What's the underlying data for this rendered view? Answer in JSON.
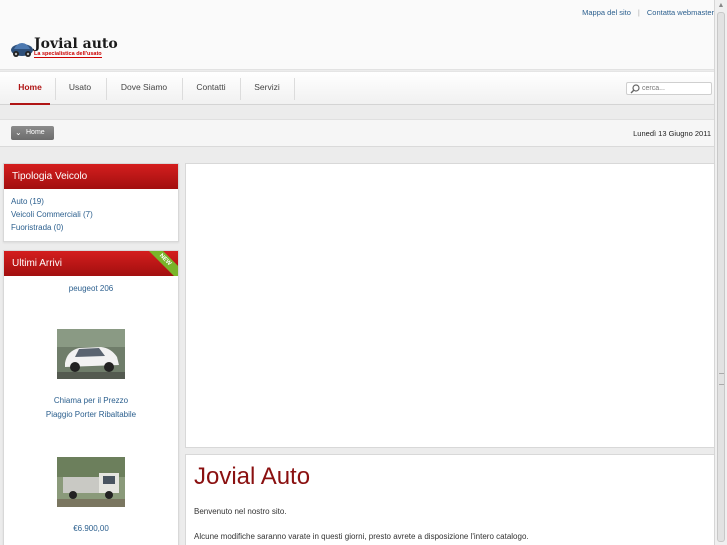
{
  "header": {
    "links": [
      "Mappa del sito",
      "Contatta webmaster"
    ],
    "logo_title": "Jovial auto",
    "logo_subtitle": "La specialistica dell'usato"
  },
  "nav": {
    "items": [
      {
        "label": "Home",
        "active": true
      },
      {
        "label": "Usato",
        "active": false
      },
      {
        "label": "Dove Siamo",
        "active": false
      },
      {
        "label": "Contatti",
        "active": false
      },
      {
        "label": "Servizi",
        "active": false
      }
    ],
    "search_placeholder": "cerca..."
  },
  "breadcrumb": {
    "label": "Home",
    "date": "Lunedì 13 Giugno 2011"
  },
  "sidebar": {
    "tipologia": {
      "title": "Tipologia Veicolo",
      "items": [
        "Auto (19)",
        "Veicoli Commerciali (7)",
        "Fuoristrada (0)"
      ]
    },
    "arrivi": {
      "title": "Ultimi Arrivi",
      "ribbon": "NEW",
      "items": [
        {
          "name": "peugeot 206",
          "price": "Chiama per il Prezzo"
        },
        {
          "name": "Piaggio Porter Ribaltabile",
          "price": "€6.900,00"
        }
      ]
    }
  },
  "main": {
    "title": "Jovial Auto",
    "p1": "Benvenuto nel nostro sito.",
    "p2": "Alcune modifiche saranno varate in questi giorni, presto avrete a disposizione l'intero catalogo."
  },
  "colors": {
    "accent": "#b01515",
    "link": "#2b5f8e",
    "ribbon": "#79b52a"
  }
}
